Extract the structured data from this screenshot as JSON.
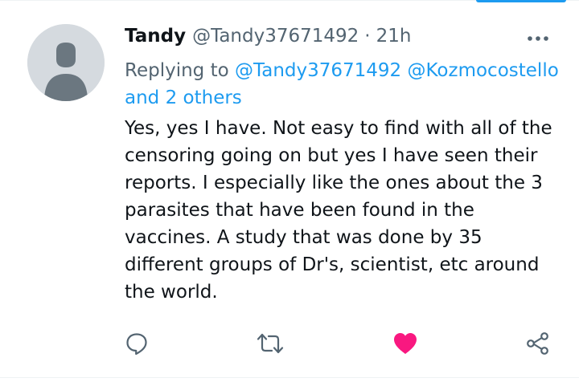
{
  "tweet": {
    "author_name": "Tandy",
    "author_handle": "@Tandy37671492",
    "separator": "·",
    "timestamp": "21h",
    "reply_context": {
      "prefix": "Replying to",
      "mentions": [
        "@Tandy37671492",
        "@Kozmocostello"
      ],
      "others": "and 2 others"
    },
    "text_lines": [
      "Yes, yes I have. Not easy to find with all of the",
      "censoring going on but yes I have seen their",
      "reports. I especially like the ones about the 3",
      "parasites that have been found in the",
      "vaccines. A study that was done by 35",
      "different groups of Dr's, scientist, etc around",
      "the world."
    ],
    "liked": true
  },
  "icons": {
    "more": "more-horizontal-icon",
    "reply": "reply-bubble-icon",
    "retweet": "retweet-icon",
    "like": "heart-icon",
    "share": "share-icon"
  },
  "colors": {
    "accent": "#1d9bf0",
    "like": "#f91880",
    "icon_gray": "#536471",
    "text": "#0f1419"
  }
}
